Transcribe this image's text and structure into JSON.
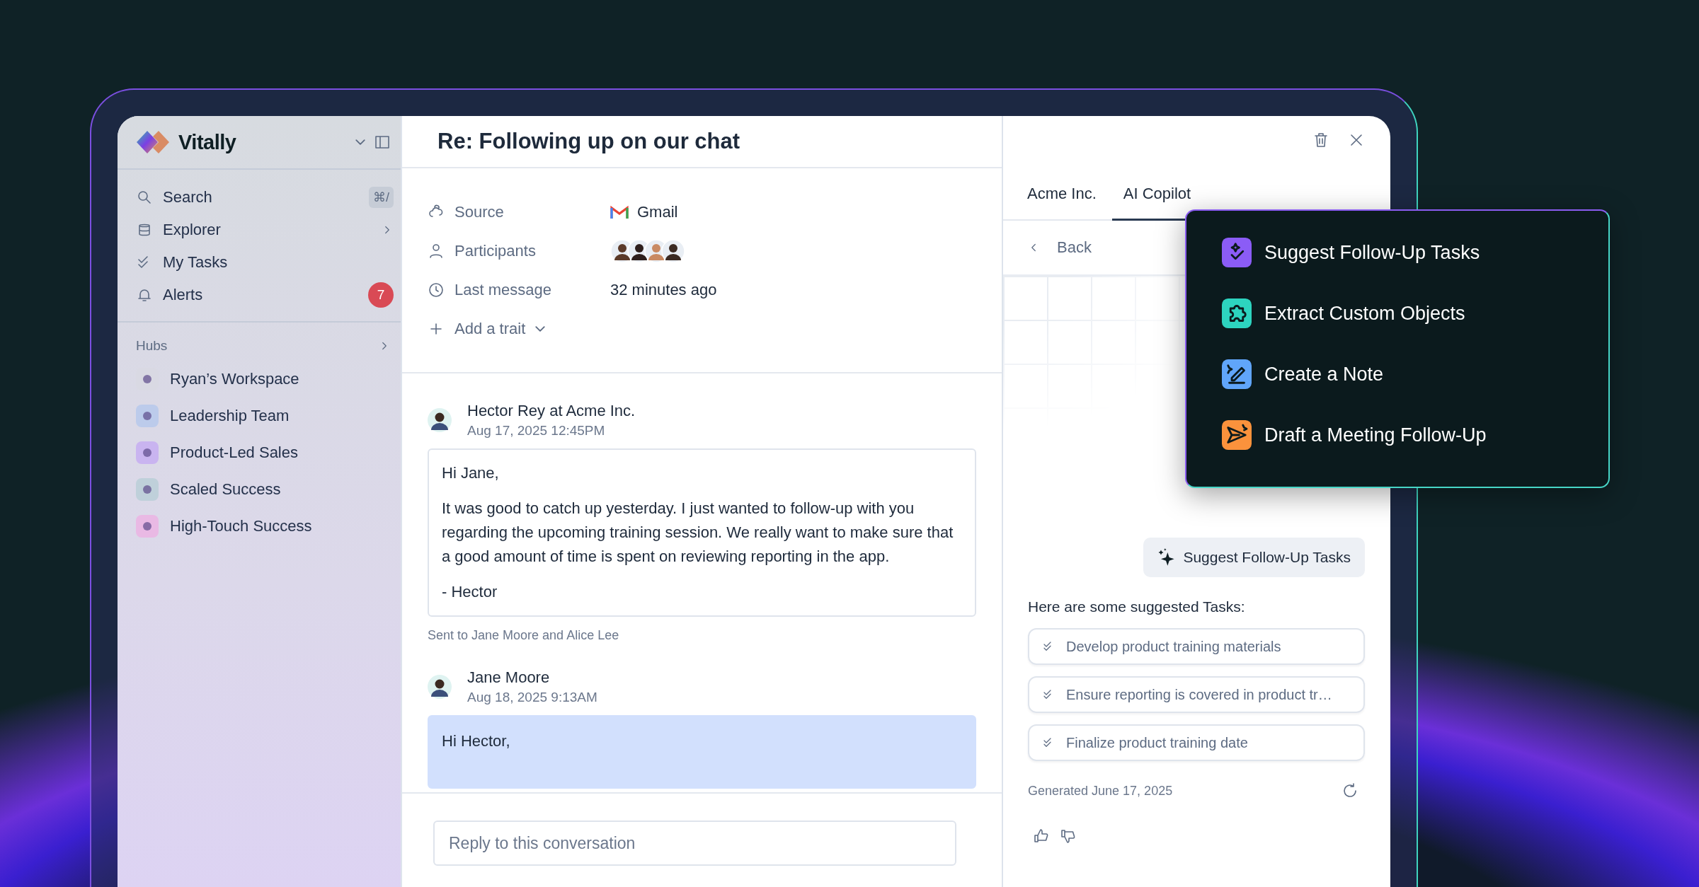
{
  "sidebar": {
    "brand": "Vitally",
    "nav": [
      {
        "label": "Search",
        "shortcut": "⌘/",
        "chevron": false
      },
      {
        "label": "Explorer",
        "chevron": true
      },
      {
        "label": "My Tasks",
        "chevron": false
      },
      {
        "label": "Alerts",
        "badge": "7",
        "chevron": false
      }
    ],
    "hubs_label": "Hubs",
    "hubs": [
      {
        "label": "Ryan’s Workspace",
        "color": "#d9d9e3"
      },
      {
        "label": "Leadership Team",
        "color": "#bccbeb"
      },
      {
        "label": "Product-Led Sales",
        "color": "#c9b4f0"
      },
      {
        "label": "Scaled Success",
        "color": "#bfd0da"
      },
      {
        "label": "High-Touch Success",
        "color": "#e9b9e4"
      }
    ]
  },
  "conversation": {
    "title": "Re: Following up on our chat",
    "traits": [
      {
        "label": "Source",
        "value": "Gmail",
        "kind": "source"
      },
      {
        "label": "Participants",
        "kind": "avatars"
      },
      {
        "label": "Last message",
        "value": "32 minutes ago",
        "kind": "text"
      }
    ],
    "add_trait": "Add a trait",
    "messages": [
      {
        "sender": "Hector Rey at Acme Inc.",
        "time": "Aug 17, 2025 12:45PM",
        "highlighted": false,
        "paragraphs": [
          "Hi Jane,",
          "It was good to catch up yesterday. I just wanted to follow-up with you regarding the upcoming training session. We really want to make sure that a good amount of time is spent on reviewing reporting in the app.",
          "- Hector"
        ],
        "sent_to": "Sent to Jane Moore and Alice Lee"
      },
      {
        "sender": "Jane Moore",
        "time": "Aug 18, 2025 9:13AM",
        "highlighted": true,
        "paragraphs": [
          "Hi Hector,"
        ]
      }
    ],
    "reply": {
      "placeholder": "Reply to this conversation"
    }
  },
  "panel": {
    "tabs": [
      {
        "label": "Acme Inc.",
        "selected": false
      },
      {
        "label": "AI Copilot",
        "selected": true
      }
    ],
    "back": "Back",
    "suggest_button": "Suggest Follow-Up Tasks",
    "intro": "Here are some suggested Tasks:",
    "tasks": [
      "Develop product training materials",
      "Ensure reporting is covered in product tr…",
      "Finalize product training date"
    ],
    "generated": "Generated June 17, 2025"
  },
  "copilot_menu": [
    {
      "label": "Suggest Follow-Up Tasks",
      "color": "#8b5cf6"
    },
    {
      "label": "Extract Custom Objects",
      "color": "#2dd4bf"
    },
    {
      "label": "Create a Note",
      "color": "#60a5fa"
    },
    {
      "label": "Draft a Meeting Follow-Up",
      "color": "#fb923c"
    }
  ]
}
